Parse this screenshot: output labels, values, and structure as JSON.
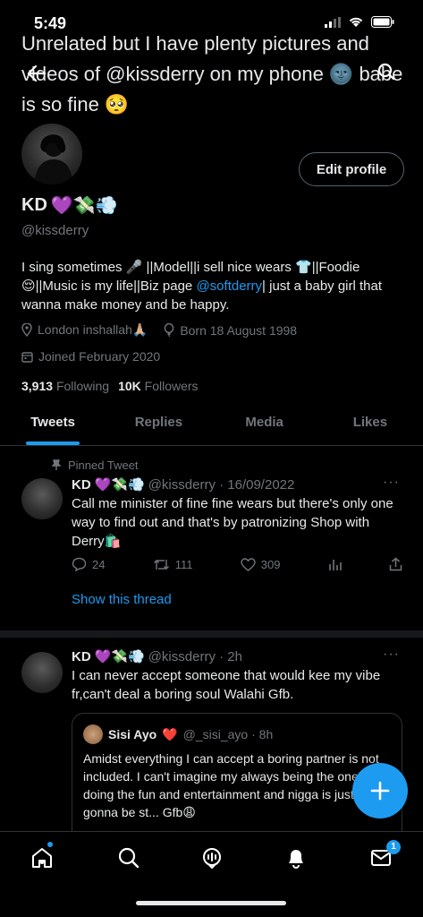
{
  "status": {
    "time": "5:49"
  },
  "caption": "Unrelated but I have plenty pictures and videos of @kissderry on my phone 🌚 babe is so fine 🥺",
  "profile": {
    "edit_button": "Edit profile",
    "name": "KD",
    "name_emojis": "💜💸💨",
    "handle": "@kissderry",
    "bio_part1": "I sing sometimes 🎤 ||Model||i sell nice wears 👕||Foodie 😌||Music is my life||Biz page ",
    "bio_link": "@softderry",
    "bio_part2": "| just a baby girl that wanna make money and be happy.",
    "location": "London inshallah🙏🏼",
    "born": "Born 18 August 1998",
    "joined": "Joined February 2020",
    "following_count": "3,913",
    "following_label": "Following",
    "followers_count": "10K",
    "followers_label": "Followers"
  },
  "tabs": [
    {
      "label": "Tweets",
      "active": true
    },
    {
      "label": "Replies",
      "active": false
    },
    {
      "label": "Media",
      "active": false
    },
    {
      "label": "Likes",
      "active": false
    }
  ],
  "tweet1": {
    "pinned_label": "Pinned Tweet",
    "name": "KD",
    "emojis": "💜💸💨",
    "meta": "@kissderry · 16/09/2022",
    "text": "Call me minister of fine fine wears but there's only one way to find out and that's by patronizing Shop with Derry🛍️",
    "replies": "24",
    "retweets": "111",
    "likes": "309",
    "show_thread": "Show this thread"
  },
  "tweet2": {
    "name": "KD",
    "emojis": "💜💸💨",
    "meta": "@kissderry · 2h",
    "text": "I can never accept someone that would kee my vibe fr,can't deal a boring soul Walahi Gfb.",
    "quote": {
      "name": "Sisi Ayo",
      "emoji": "❤️",
      "meta": "@_sisi_ayo · 8h",
      "text": "Amidst everything I can accept a boring partner is not included. I can't imagine my always being the one doing the fun and entertainment and nigga is just gonna be st... Gfb😩"
    }
  },
  "nav": {
    "messages_badge": "1"
  },
  "colors": {
    "accent": "#1d9bf0",
    "background": "#000000",
    "muted": "#71767b"
  }
}
